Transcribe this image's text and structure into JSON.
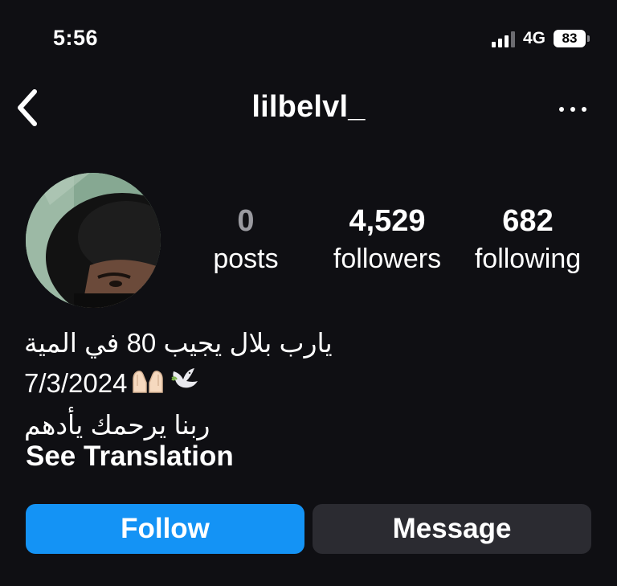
{
  "status_bar": {
    "time": "5:56",
    "network": "4G",
    "battery": "83"
  },
  "header": {
    "username": "lilbelvl_",
    "back_icon": "chevron-left-icon",
    "more_icon": "more-horizontal-icon"
  },
  "stats": {
    "posts": {
      "value": "0",
      "label": "posts"
    },
    "followers": {
      "value": "4,529",
      "label": "followers"
    },
    "following": {
      "value": "682",
      "label": "following"
    }
  },
  "bio": {
    "line1": "يارب بلال يجيب 80 في المية",
    "line2_date": "7/3/2024",
    "line2_emojis": [
      "praying-hands-icon",
      "dove-icon"
    ],
    "line3": "ربنا يرحمك يأدهم",
    "see_translation": "See Translation"
  },
  "actions": {
    "follow": "Follow",
    "message": "Message"
  },
  "colors": {
    "background": "#0f0f13",
    "follow_button": "#1493f5",
    "message_button": "#2b2b31",
    "posts_count": "#9a9aa0"
  }
}
